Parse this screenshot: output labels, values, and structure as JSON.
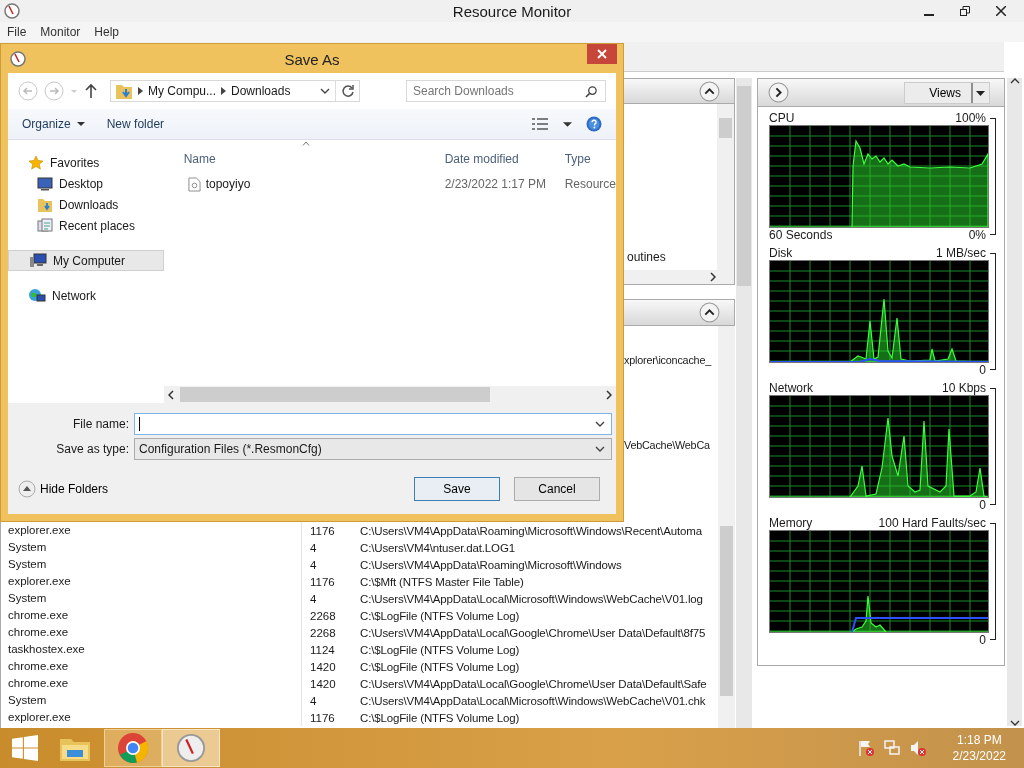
{
  "window": {
    "title": "Resource Monitor"
  },
  "menu": [
    {
      "label": "File"
    },
    {
      "label": "Monitor"
    },
    {
      "label": "Help"
    }
  ],
  "upper_section": {
    "visible_text": "outines"
  },
  "disk_section": {
    "partial_rows": [
      {
        "file": "xplorer\\iconcache_"
      },
      {
        "file": "VebCache\\WebCa"
      }
    ],
    "rows": [
      {
        "image": "explorer.exe",
        "pid": "1176",
        "file": "C:\\Users\\VM4\\AppData\\Roaming\\Microsoft\\Windows\\Recent\\Automa"
      },
      {
        "image": "System",
        "pid": "4",
        "file": "C:\\Users\\VM4\\ntuser.dat.LOG1"
      },
      {
        "image": "System",
        "pid": "4",
        "file": "C:\\Users\\VM4\\AppData\\Roaming\\Microsoft\\Windows"
      },
      {
        "image": "explorer.exe",
        "pid": "1176",
        "file": "C:\\$Mft (NTFS Master File Table)"
      },
      {
        "image": "System",
        "pid": "4",
        "file": "C:\\Users\\VM4\\AppData\\Local\\Microsoft\\Windows\\WebCache\\V01.log"
      },
      {
        "image": "chrome.exe",
        "pid": "2268",
        "file": "C:\\$LogFile (NTFS Volume Log)"
      },
      {
        "image": "chrome.exe",
        "pid": "2268",
        "file": "C:\\Users\\VM4\\AppData\\Local\\Google\\Chrome\\User Data\\Default\\8f75"
      },
      {
        "image": "taskhostex.exe",
        "pid": "1124",
        "file": "C:\\$LogFile (NTFS Volume Log)"
      },
      {
        "image": "chrome.exe",
        "pid": "1420",
        "file": "C:\\$LogFile (NTFS Volume Log)"
      },
      {
        "image": "chrome.exe",
        "pid": "1420",
        "file": "C:\\Users\\VM4\\AppData\\Local\\Google\\Chrome\\User Data\\Default\\Safe"
      },
      {
        "image": "System",
        "pid": "4",
        "file": "C:\\Users\\VM4\\AppData\\Local\\Microsoft\\Windows\\WebCache\\V01.chk"
      },
      {
        "image": "explorer.exe",
        "pid": "1176",
        "file": "C:\\$LogFile (NTFS Volume Log)"
      }
    ]
  },
  "graphs_panel": {
    "views_button": "Views",
    "graphs": [
      {
        "kind": "cpu",
        "title": "CPU",
        "scale_max": "100%",
        "scale_min": "0%",
        "time_label": "60 Seconds"
      },
      {
        "kind": "disk",
        "title": "Disk",
        "scale_max": "1 MB/sec",
        "scale_min": "0"
      },
      {
        "kind": "network",
        "title": "Network",
        "scale_max": "10 Kbps",
        "scale_min": "0"
      },
      {
        "kind": "memory",
        "title": "Memory",
        "scale_max": "100 Hard Faults/sec",
        "scale_min": "0"
      }
    ]
  },
  "dialog": {
    "title": "Save As",
    "breadcrumbs": [
      "My Compu...",
      "Downloads"
    ],
    "search": {
      "placeholder": "Search Downloads"
    },
    "toolbar": [
      {
        "label": "Organize",
        "kind": "menu"
      },
      {
        "label": "New folder",
        "kind": "button"
      }
    ],
    "nav": [
      {
        "label": "Favorites",
        "kind": "favorites",
        "selected": false,
        "children": [
          {
            "label": "Desktop",
            "kind": "desktop",
            "selected": false
          },
          {
            "label": "Downloads",
            "kind": "downloads",
            "selected": false
          },
          {
            "label": "Recent places",
            "kind": "recent",
            "selected": false
          }
        ]
      },
      {
        "label": "My Computer",
        "kind": "computer",
        "selected": true
      },
      {
        "label": "Network",
        "kind": "network",
        "selected": false
      }
    ],
    "columns": [
      "Name",
      "Date modified",
      "Type"
    ],
    "files": [
      {
        "name": "topoyiyo",
        "date": "2/23/2022 1:17 PM",
        "type": "Resource"
      }
    ],
    "file_name": {
      "label": "File name:"
    },
    "save_type": {
      "label": "Save as type:",
      "value": "Configuration Files (*.ResmonCfg)"
    },
    "hide_folders": "Hide Folders",
    "buttons": [
      {
        "label": "Save",
        "default": true
      },
      {
        "label": "Cancel",
        "default": false
      }
    ]
  },
  "taskbar": {
    "apps": [
      {
        "kind": "explorer",
        "running": false,
        "selected": false
      },
      {
        "kind": "browser",
        "running": true,
        "selected": false
      },
      {
        "kind": "gauge",
        "running": true,
        "selected": true
      }
    ],
    "clock": {
      "time": "1:18 PM",
      "date": "2/23/2022"
    }
  }
}
